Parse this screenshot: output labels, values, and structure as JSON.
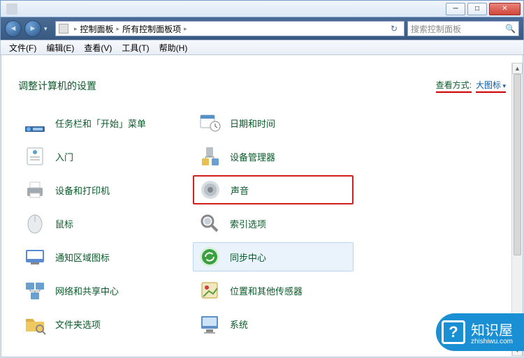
{
  "titlebar": {
    "title": ""
  },
  "nav": {
    "root": "控制面板",
    "current": "所有控制面板项",
    "search_placeholder": "搜索控制面板"
  },
  "menu": {
    "file": "文件(F)",
    "edit": "编辑(E)",
    "view": "查看(V)",
    "tools": "工具(T)",
    "help": "帮助(H)"
  },
  "header": {
    "title": "调整计算机的设置",
    "view_label": "查看方式:",
    "view_value": "大图标"
  },
  "items": [
    {
      "id": "taskbar-start",
      "label": "任务栏和「开始」菜单"
    },
    {
      "id": "date-time",
      "label": "日期和时间"
    },
    {
      "id": "getting-started",
      "label": "入门"
    },
    {
      "id": "device-manager",
      "label": "设备管理器"
    },
    {
      "id": "devices-printers",
      "label": "设备和打印机"
    },
    {
      "id": "sound",
      "label": "声音",
      "highlight": true
    },
    {
      "id": "mouse",
      "label": "鼠标"
    },
    {
      "id": "indexing",
      "label": "索引选项"
    },
    {
      "id": "notification-icons",
      "label": "通知区域图标"
    },
    {
      "id": "sync-center",
      "label": "同步中心",
      "hover": true
    },
    {
      "id": "network-sharing",
      "label": "网络和共享中心"
    },
    {
      "id": "location-sensors",
      "label": "位置和其他传感器"
    },
    {
      "id": "folder-options",
      "label": "文件夹选项"
    },
    {
      "id": "system",
      "label": "系统"
    }
  ],
  "icons": {
    "taskbar-start": "#4a90d9",
    "date-time": "#6aa0d0",
    "getting-started": "#5aa0d8",
    "device-manager": "#8898a8",
    "devices-printers": "#808890",
    "sound": "#9aa8b0",
    "mouse": "#c8ccd0",
    "indexing": "#b0b8c0",
    "notification-icons": "#5a8ad0",
    "sync-center": "#3aa040",
    "network-sharing": "#4a88c0",
    "location-sensors": "#d0b040",
    "folder-options": "#e0b050",
    "system": "#6090c8"
  },
  "watermark": {
    "name": "知识屋",
    "url": "zhishiwu.com"
  }
}
